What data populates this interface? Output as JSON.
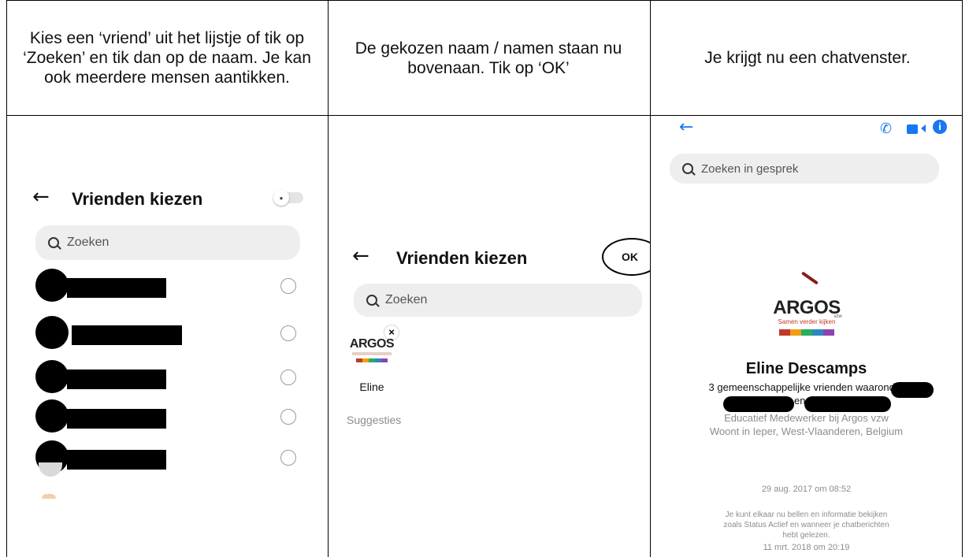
{
  "instructions": {
    "col1": "Kies een ‘vriend’ uit het lijstje of tik op ‘Zoeken’ en tik dan op de naam. Je kan ook meerdere mensen aantikken.",
    "col2": "De gekozen naam / namen staan nu bovenaan. Tik op ‘OK’",
    "col3": "Je krijgt nu een chatvenster."
  },
  "screen1": {
    "title": "Vrienden kiezen",
    "search_placeholder": "Zoeken",
    "friends": [
      {
        "name": "",
        "selected": false
      },
      {
        "name": "",
        "selected": false
      },
      {
        "name": "",
        "selected": false
      },
      {
        "name": "",
        "selected": false
      },
      {
        "name": "",
        "selected": false
      }
    ],
    "icons": {
      "back": "arrow-left-icon",
      "toggle": "lock-toggle-icon"
    }
  },
  "screen2": {
    "title": "Vrienden kiezen",
    "ok_label": "OK",
    "search_placeholder": "Zoeken",
    "selected_name": "Eline",
    "logo_text": "ARGOS",
    "remove_mark": "×",
    "suggestions_label": "Suggesties"
  },
  "screen3": {
    "search_placeholder": "Zoeken in gesprek",
    "logo_text": "ARGOS",
    "logo_tagline": "Samen verder kijken",
    "logo_suffix": "vzw",
    "profile_name": "Eline Descamps",
    "mutual_friends": "3 gemeenschappelijke vrienden waaronder",
    "mutual_friends_2": "en M",
    "job": "Educatief Medewerker bij Argos vzw",
    "lives": "Woont in Ieper, West-Vlaanderen, Belgium",
    "date1": "29 aug. 2017 om 08:52",
    "notice": "Je kunt elkaar nu bellen en informatie bekijken zoals Status Actief en wanneer je chatberichten hebt gelezen.",
    "date2": "11 mrt. 2018 om 20:19",
    "accent_color": "#1877f2",
    "icons": {
      "back": "arrow-left-icon",
      "call": "phone-icon",
      "video": "video-camera-icon",
      "info": "info-icon"
    }
  }
}
